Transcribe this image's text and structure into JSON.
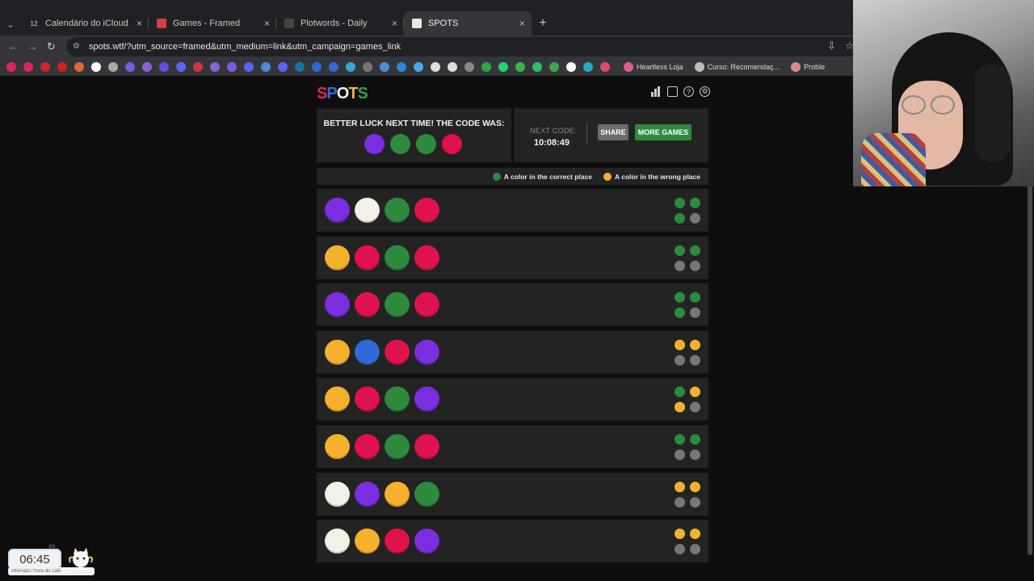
{
  "browser": {
    "tabs": [
      {
        "label": "Calendário do iCloud",
        "favicon_text": "12",
        "favicon_color": "#2b2b2b",
        "active": false
      },
      {
        "label": "Games - Framed",
        "favicon_text": "",
        "favicon_color": "#d63b4b",
        "active": false
      },
      {
        "label": "Plotwords - Daily",
        "favicon_text": "",
        "favicon_color": "#444444",
        "active": false
      },
      {
        "label": "SPOTS",
        "favicon_text": "",
        "favicon_color": "#e8e8e8",
        "active": true
      }
    ],
    "close_glyph": "×",
    "new_tab_glyph": "+",
    "url": "spots.wtf/?utm_source=framed&utm_medium=link&utm_campaign=games_link",
    "bookmarks": [
      {
        "label": "Heartless Loja",
        "icon_color": "#e25b8f"
      },
      {
        "label": "Curso: Recomendaç...",
        "icon_color": "#bbbbbb"
      },
      {
        "label": "Proble",
        "icon_color": "#d98a8a"
      }
    ],
    "bookmark_icon_colors": [
      "#e0245e",
      "#e0245e",
      "#cc2a2a",
      "#d02020",
      "#e06a2a",
      "#ffffff",
      "#aaaaaa",
      "#7a5be8",
      "#8a63d2",
      "#6a4bd8",
      "#5865f2",
      "#cc3b3b",
      "#8a63d2",
      "#7a5be8",
      "#5865f2",
      "#4a8bd8",
      "#5865f2",
      "#1a73a8",
      "#2b6cd8",
      "#2f6bd8",
      "#3aa5d8",
      "#777777",
      "#4a8fd8",
      "#2a89d8",
      "#4aa8e0",
      "#dddddd",
      "#dddddd",
      "#888888",
      "#2aa84a",
      "#25d366",
      "#3bb54a",
      "#2fc05a",
      "#3aa84a",
      "#ffffff",
      "#2aa8c8",
      "#e04a6a"
    ]
  },
  "game": {
    "logo_letters": [
      {
        "char": "S",
        "color": "#e0245e"
      },
      {
        "char": "P",
        "color": "#2f6bd8"
      },
      {
        "char": "O",
        "color": "#f3f0e6"
      },
      {
        "char": "T",
        "color": "#f5b43a"
      },
      {
        "char": "S",
        "color": "#3a9a4e"
      }
    ],
    "header_icons": [
      "stats-icon",
      "calendar-icon",
      "help-icon",
      "settings-icon"
    ],
    "result_title": "BETTER LUCK NEXT TIME! THE CODE WAS:",
    "code": [
      "purple",
      "green",
      "green",
      "red"
    ],
    "next_code_label": "NEXT CODE:",
    "next_code_time": "10:08:49",
    "share_label": "SHARE",
    "more_games_label": "MORE GAMES",
    "legend_correct": "A color in the correct place",
    "legend_wrong": "A color in the wrong place",
    "colors": {
      "purple": "#7b2de0",
      "green": "#2e8b3e",
      "red": "#e0124e",
      "white": "#f3f0e6",
      "yellow": "#f5b12e",
      "blue": "#2f6bd8",
      "fb_green": "#2e8b3e",
      "fb_yellow": "#f5b12e",
      "fb_gray": "#777777"
    },
    "guesses": [
      {
        "pegs": [
          "purple",
          "white",
          "green",
          "red"
        ],
        "feedback": [
          "green",
          "green",
          "green",
          "gray"
        ]
      },
      {
        "pegs": [
          "yellow",
          "red",
          "green",
          "red"
        ],
        "feedback": [
          "green",
          "green",
          "gray",
          "gray"
        ]
      },
      {
        "pegs": [
          "purple",
          "red",
          "green",
          "red"
        ],
        "feedback": [
          "green",
          "green",
          "green",
          "gray"
        ]
      },
      {
        "pegs": [
          "yellow",
          "blue",
          "red",
          "purple"
        ],
        "feedback": [
          "yellow",
          "yellow",
          "gray",
          "gray"
        ]
      },
      {
        "pegs": [
          "yellow",
          "red",
          "green",
          "purple"
        ],
        "feedback": [
          "green",
          "yellow",
          "yellow",
          "gray"
        ]
      },
      {
        "pegs": [
          "yellow",
          "red",
          "green",
          "red"
        ],
        "feedback": [
          "green",
          "green",
          "gray",
          "gray"
        ]
      },
      {
        "pegs": [
          "white",
          "purple",
          "yellow",
          "green"
        ],
        "feedback": [
          "yellow",
          "yellow",
          "gray",
          "gray"
        ]
      },
      {
        "pegs": [
          "white",
          "yellow",
          "red",
          "purple"
        ],
        "feedback": [
          "yellow",
          "yellow",
          "gray",
          "gray"
        ]
      }
    ]
  },
  "overlay": {
    "clock_time": "06:45",
    "clock_counter": "3/5",
    "clock_caption": "Intervalo / hora do café"
  }
}
